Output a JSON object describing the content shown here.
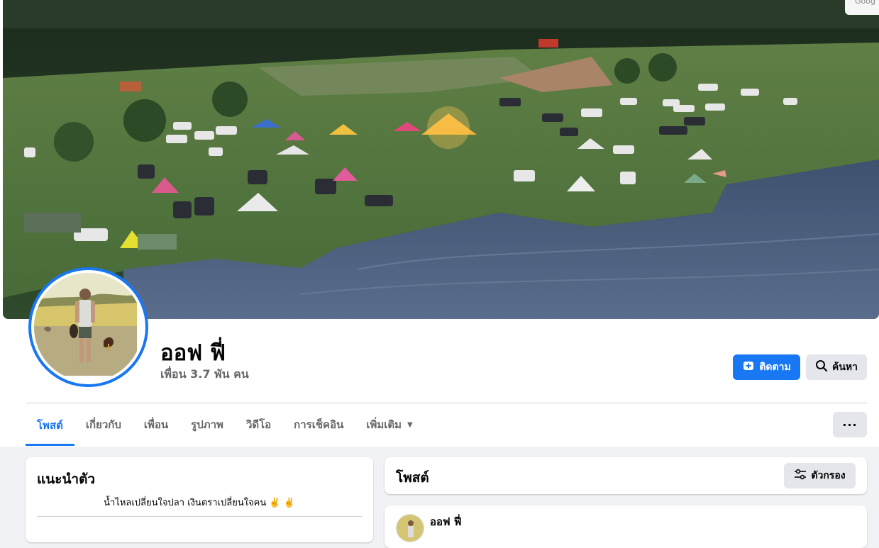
{
  "profile": {
    "name": "ออฟ ฟี่",
    "friends": "เพื่อน 3.7 พัน คน"
  },
  "actions": {
    "follow_label": "ติดตาม",
    "search_label": "ค้นหา",
    "more_label": "···"
  },
  "tabs": [
    {
      "label": "โพสต์",
      "active": true
    },
    {
      "label": "เกี่ยวกับ",
      "active": false
    },
    {
      "label": "เพื่อน",
      "active": false
    },
    {
      "label": "รูปภาพ",
      "active": false
    },
    {
      "label": "วิดีโอ",
      "active": false
    },
    {
      "label": "การเช็คอิน",
      "active": false
    },
    {
      "label": "เพิ่มเติม",
      "active": false
    }
  ],
  "intro": {
    "title": "แนะนำตัว",
    "bio": "น้ำไหลเปลี่ยนใจปลา เงินตราเปลี่ยนใจคน ✌️ ✌️"
  },
  "posts": {
    "title": "โพสต์",
    "filter_label": "ตัวกรอง",
    "first_author": "ออฟ ฟี่"
  },
  "corner_chip": "Goog",
  "colors": {
    "accent": "#1877f2",
    "background": "#f0f2f5",
    "secondary_text": "#65676b"
  }
}
